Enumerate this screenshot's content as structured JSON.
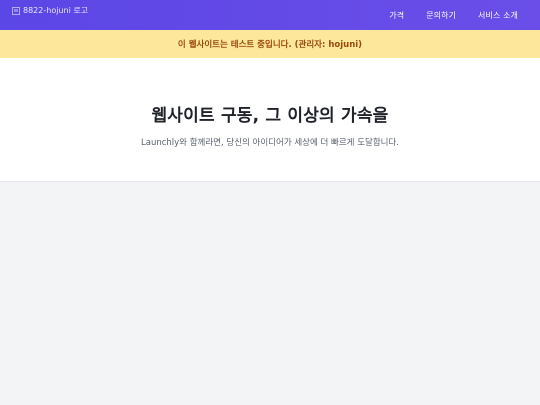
{
  "header": {
    "logo_alt": "8822-hojuni 로고",
    "nav": [
      {
        "label": "가격"
      },
      {
        "label": "문의하기"
      },
      {
        "label": "서비스 소개"
      }
    ]
  },
  "notice": {
    "text": "이 웹사이트는 테스트 중입니다. (관리자: hojuni)"
  },
  "hero": {
    "title": "웹사이트 구동, 그 이상의 가속을",
    "subtitle": "Launchly와 함께라면, 당신의 아이디어가 세상에 더 빠르게 도달합니다."
  },
  "colors": {
    "navbar": "#5b46e6",
    "notice_bg": "#fde79a",
    "notice_text": "#9a4a0f",
    "page_bg": "#f3f4f6"
  }
}
